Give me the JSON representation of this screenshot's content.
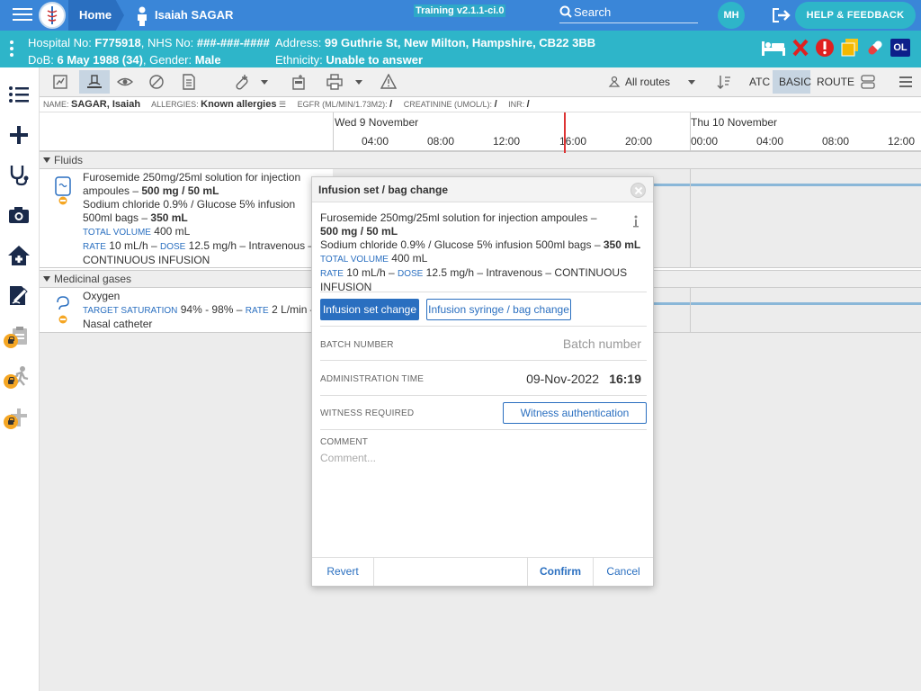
{
  "header": {
    "home_label": "Home",
    "patient_name": "Isaiah SAGAR",
    "training_badge": "Training v2.1.1-ci.0",
    "search_label": "Search",
    "user_initials": "MH",
    "help_label": "HELP & FEEDBACK"
  },
  "banner": {
    "hospital_no_label": "Hospital No: ",
    "hospital_no": "F775918",
    "nhs_label": ", NHS No: ",
    "nhs_no": "###-###-####",
    "dob_label": "DoB: ",
    "dob": "6 May 1988 (34)",
    "gender_label": ", Gender: ",
    "gender": "Male",
    "address_label": "Address: ",
    "address": "99 Guthrie St, New Milton, Hampshire, CB22 3BB",
    "ethnicity_label": "Ethnicity: ",
    "ethnicity": "Unable to answer",
    "ol_badge": "OL"
  },
  "toolbar": {
    "routes_label": "All routes",
    "atc_label": "ATC",
    "basic_label": "BASIC",
    "route_label": "ROUTE"
  },
  "infoline": {
    "name_label": "NAME:",
    "name": "SAGAR, Isaiah",
    "allergies_label": "ALLERGIES:",
    "allergies": "Known allergies",
    "egfr_label": "EGFR (ML/MIN/1.73M2):",
    "egfr": "/",
    "creatinine_label": "CREATININE (UMOL/L):",
    "creatinine": "/",
    "inr_label": "INR:",
    "inr": "/"
  },
  "timeline": {
    "day1": "Wed 9 November",
    "day2": "Thu 10 November",
    "hours": [
      "04:00",
      "08:00",
      "12:00",
      "16:00",
      "20:00",
      "00:00",
      "04:00",
      "08:00",
      "12:00"
    ]
  },
  "sections": {
    "fluids": "Fluids",
    "gases": "Medicinal gases"
  },
  "fluid_row": {
    "line1": "Furosemide 250mg/25ml solution for injection",
    "line2a": "ampoules – ",
    "line2b": "500 mg / 50 mL",
    "line3": "Sodium chloride 0.9% / Glucose 5% infusion",
    "line4a": "500ml bags – ",
    "line4b": "350 mL",
    "vol_label": "TOTAL VOLUME",
    "vol": "400 mL",
    "rate_label": "RATE",
    "rate": "10 mL/h – ",
    "dose_label": "DOSE",
    "dose": "12.5 mg/h – Intravenous –",
    "mode": "CONTINUOUS INFUSION"
  },
  "gas_row": {
    "name": "Oxygen",
    "sat_label": "TARGET SATURATION",
    "sat": "94% - 98% – ",
    "rate_label": "RATE",
    "rate": "2 L/min –",
    "route": "Nasal catheter"
  },
  "modal": {
    "title": "Infusion set / bag change",
    "line1": "Furosemide 250mg/25ml solution for injection ampoules –",
    "line2": "500 mg / 50 mL",
    "line3a": "Sodium chloride 0.9% / Glucose 5% infusion 500ml bags – ",
    "line3b": "350 mL",
    "vol_label": "TOTAL VOLUME",
    "vol": "400 mL",
    "rate_label": "RATE",
    "rate": "10 mL/h – ",
    "dose_label": "DOSE",
    "dose": "12.5 mg/h – Intravenous – CONTINUOUS",
    "mode": "INFUSION",
    "btn_set_change": "Infusion set change",
    "btn_syringe_change": "Infusion syringe / bag change",
    "batch_label": "BATCH NUMBER",
    "batch_placeholder": "Batch number",
    "admin_time_label": "ADMINISTRATION TIME",
    "admin_date": "09-Nov-2022",
    "admin_time": "16:19",
    "witness_label": "WITNESS REQUIRED",
    "witness_btn": "Witness authentication",
    "comment_label": "COMMENT",
    "comment_placeholder": "Comment...",
    "revert": "Revert",
    "confirm": "Confirm",
    "cancel": "Cancel"
  },
  "colors": {
    "primary": "#3a86d8",
    "teal": "#2eb5c9",
    "link": "#2a6fc0",
    "now_line": "#dd3333"
  }
}
